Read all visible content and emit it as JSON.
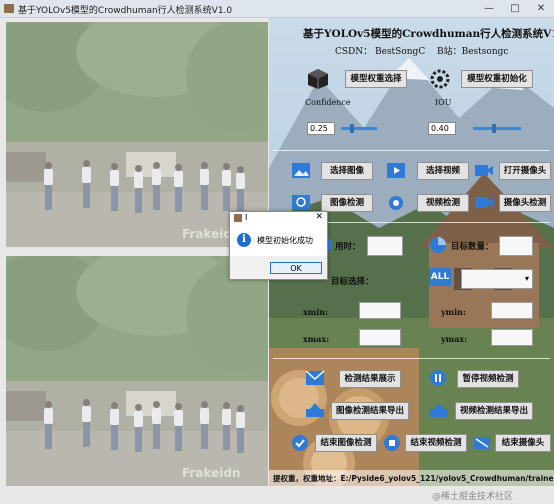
{
  "window": {
    "title": "基于YOLOv5模型的Crowdhuman行人检测系统V1.0",
    "controls": [
      "—",
      "□",
      "✕"
    ]
  },
  "left": {
    "watermark": "Frakeidn"
  },
  "header": {
    "title": "基于YOLOv5模型的Crowdhuman行人检测系统V1.0",
    "csdn": "CSDN： BestSongC",
    "bilibili": "B站：Bestsongc"
  },
  "model": {
    "select_label": "模型权重选择",
    "init_label": "模型权重初始化",
    "confidence_label": "Confidence",
    "confidence_value": "0.25",
    "confidence_level": 0.25,
    "iou_label": "IOU",
    "iou_value": "0.40",
    "iou_level": 0.4
  },
  "io": {
    "select_image": "选择图像",
    "select_video": "选择视频",
    "open_camera": "打开摄像头",
    "image_detect": "图像检测",
    "video_detect": "视频检测",
    "camera_detect": "摄像头检测"
  },
  "stats": {
    "time_label": "用时：",
    "target_count_label": "目标数量：",
    "target_select_label": "目标选择：",
    "all_label": "ALL",
    "xmin_label": "xmin:",
    "ymin_label": "ymin:",
    "xmax_label": "xmax:",
    "ymax_label": "ymax:"
  },
  "actions": {
    "show_result": "检测结果展示",
    "pause_video": "暂停视频检测",
    "export_image": "图像检测结果导出",
    "export_video": "视频检测结果导出",
    "end_image": "结束图像检测",
    "end_video": "结束视频检测",
    "end_camera": "结束摄像头"
  },
  "statusbar": {
    "text": "提权重，权重地址：E:/Pyside6_yolov5_121/yolov5_Crowdhuman/trained/weights/best.pt"
  },
  "dialog": {
    "title": "I",
    "message": "模型初始化成功",
    "ok_label": "OK"
  },
  "watermark_bottom": "@稀土掘金技术社区",
  "colors": {
    "accent": "#1f6fd0",
    "slider": "#3b87d8",
    "sky": "#a9c6dc",
    "forest": "#3e5d32"
  }
}
